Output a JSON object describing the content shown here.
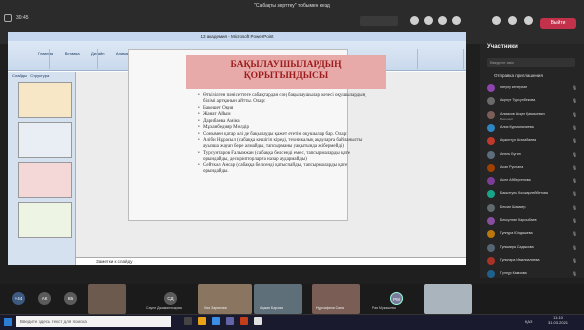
{
  "window": {
    "title": "\"Сабақты зерттеу\" тобымен кезд",
    "time": "30:45",
    "leave": "Выйти"
  },
  "ppt": {
    "title": "13 академия - Microsoft PowerPoint",
    "tabs": [
      "Главная",
      "Вставка",
      "Дизайн",
      "Анимация",
      "Показ слайдов",
      "Рецензирование",
      "Вид"
    ],
    "panel_tabs": [
      "Слайды",
      "Структура"
    ],
    "notes": "Заметки к слайду"
  },
  "slide": {
    "title_line1": "БАҚЫЛАУШЫЛАРДЫҢ",
    "title_line2": "ҚОРЫТЫНДЫСЫ",
    "bullets": [
      "Өткізілген пәнісеттеге сабақтардан соң бақылаушылар кезесі оқушылардың білімі артқанын айтты. Олар:",
      "Бакешет Оқия",
      "Жанат Айым",
      "Дарибаева Аміна",
      "Мұханбедияр Мөлдір",
      "Сонымен қатар әлі де бақылауды қажет ететін оқушылар бар. Олар:",
      "Аліби Нұрасыл (сабаққа кешігіп кіреді, техникалық ақауларға байланысты ауызша жауап бере алмайды, тапсырманы уақытында жібермейді)",
      "Турсунтаров Ғалымжан (сабаққа белсенді емес, тапсырмаларды қате орындайды, дескрипторларға назар аудармайды)",
      "Сейткәл Ансар (сабаққа белсенді қатыспайды, тапсырмаларды қате орындайды."
    ]
  },
  "participants": {
    "header": "Участники",
    "search": "Введите имя",
    "invite": "Отправка приглашения",
    "list": [
      {
        "name": "нигуну кенерхан",
        "sub": "",
        "color": "#8e44ad"
      },
      {
        "name": "Акрнүт Турсунбекова",
        "sub": "",
        "color": "#6a6a6a"
      },
      {
        "name": "Алмасов Асқат Қамсыевич",
        "sub": "Внешний",
        "color": "#7b5e57"
      },
      {
        "name": "Алия Курманалиева",
        "sub": "",
        "color": "#2e86c1"
      },
      {
        "name": "Ақжолтұл Агахабаева",
        "sub": "",
        "color": "#c0392b"
      },
      {
        "name": "Анель Бүгин",
        "sub": "",
        "color": "#5d6d7e"
      },
      {
        "name": "Асан Руслана",
        "sub": "",
        "color": "#a04000"
      },
      {
        "name": "Асел Айбергенова",
        "sub": "",
        "color": "#7d3c98"
      },
      {
        "name": "Бакытгуль Косжарлейбетова",
        "sub": "",
        "color": "#17a589"
      },
      {
        "name": "Бекзат Шамкер",
        "sub": "",
        "color": "#616a6b"
      },
      {
        "name": "Бексултан Карсыбаев",
        "sub": "",
        "color": "#884ea0"
      },
      {
        "name": "Гулнура Юлдашева",
        "sub": "",
        "color": "#b9770e"
      },
      {
        "name": "Гульмира Садыкова",
        "sub": "",
        "color": "#566573"
      },
      {
        "name": "Гульнара Ималиалиева",
        "sub": "",
        "color": "#a93226"
      },
      {
        "name": "Гүлнұр Камзова",
        "sub": "",
        "color": "#1f618d"
      }
    ]
  },
  "gallery": {
    "more": "+44",
    "circles": [
      "АК",
      "КБ",
      "СД",
      "РМ"
    ],
    "names": [
      "Сауле Джаманлықова",
      "Лия Зарипова",
      "Ақжан Барова",
      "Нұрсафина Сапа",
      "Рая Мукашева"
    ]
  },
  "taskbar": {
    "search": "Введите здесь текст для поиска",
    "lang": "ҚАЗ",
    "time": "11:10",
    "date": "31.03.2021"
  }
}
